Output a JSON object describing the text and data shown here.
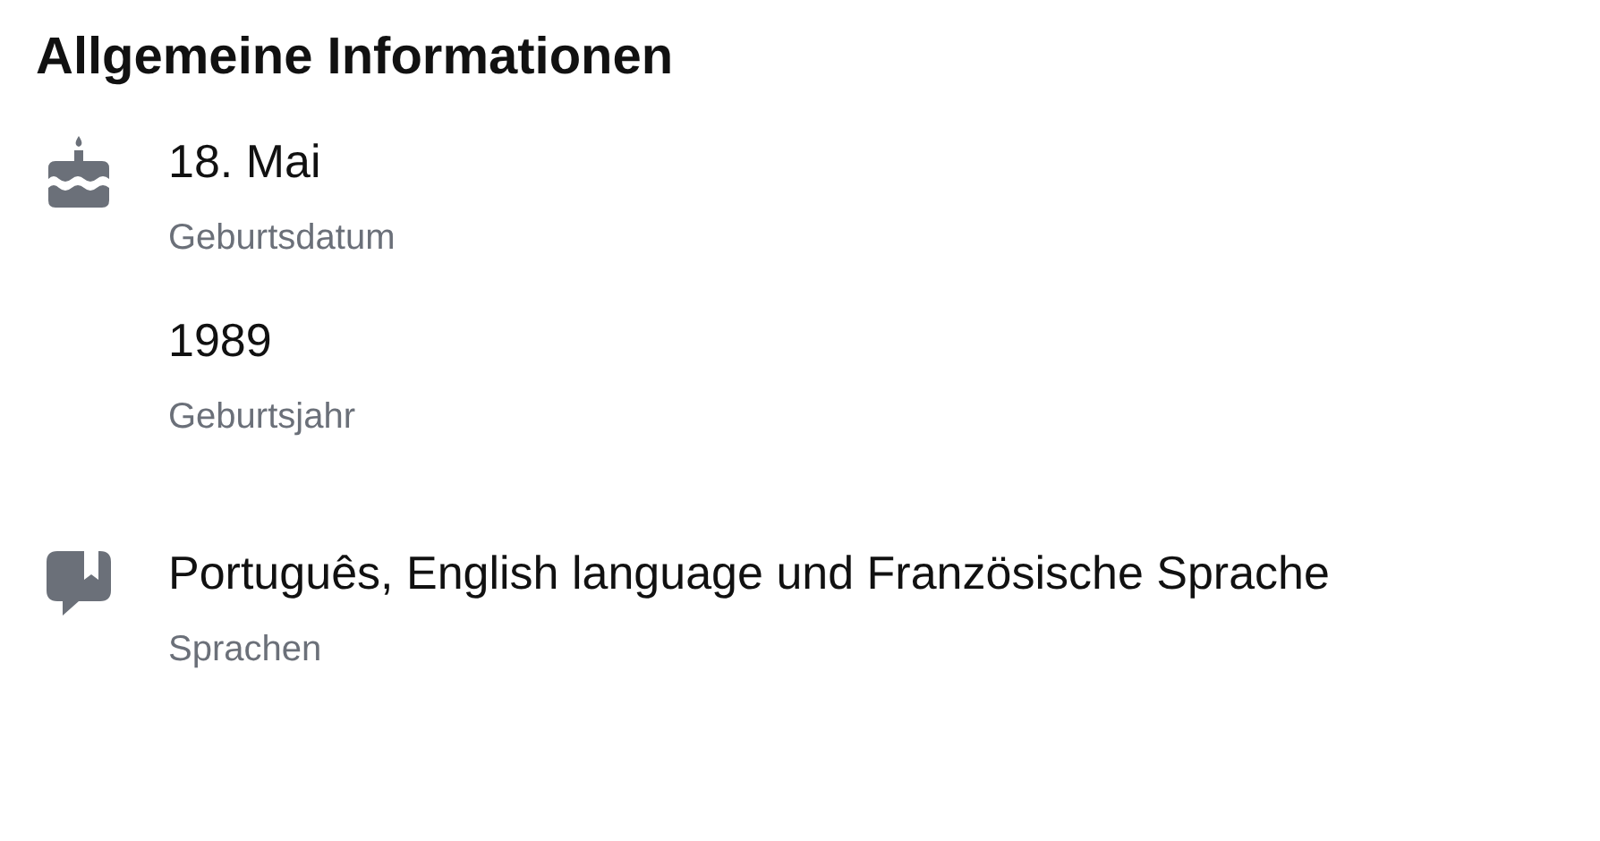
{
  "title": "Allgemeine Informationen",
  "sections": [
    {
      "items": [
        {
          "kind": "birthday",
          "value": "18. Mai",
          "label": "Geburtsdatum"
        },
        {
          "kind": "plain",
          "value": "1989",
          "label": "Geburtsjahr"
        }
      ]
    },
    {
      "items": [
        {
          "kind": "languages",
          "value": "Português, English language und Französische Sprache",
          "label": "Sprachen"
        }
      ]
    }
  ]
}
